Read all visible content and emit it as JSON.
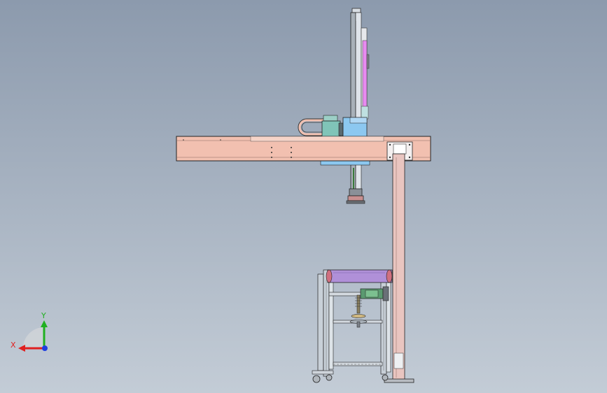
{
  "viewport": {
    "background_top": "#8c9aad",
    "background_bottom": "#c3ccd6"
  },
  "model": {
    "beam_color": "#f2c0b0",
    "column_color": "#e9c5c0",
    "carriage_color": "#8cc8f0",
    "accent_magenta": "#e78af0",
    "roller_color": "#b090d8",
    "frame_color": "#c8d0d8"
  },
  "triad": {
    "x_label": "X",
    "y_label": "Y",
    "x_color": "#e02020",
    "y_color": "#20b020",
    "z_color": "#2040e0"
  }
}
